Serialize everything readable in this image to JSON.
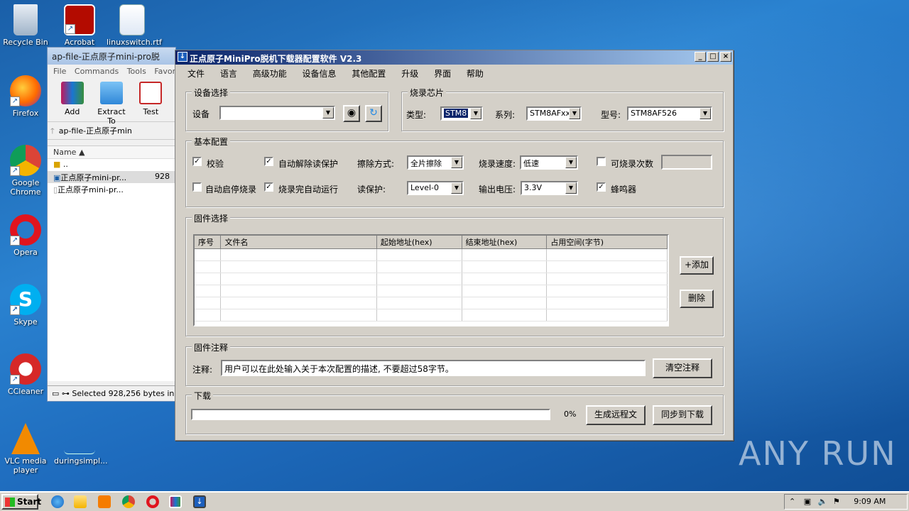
{
  "desktop": {
    "icons": [
      {
        "label": "Recycle Bin"
      },
      {
        "label": "Acrobat"
      },
      {
        "label": "linuxswitch.rtf"
      },
      {
        "label": "Firefox"
      },
      {
        "label": "Google Chrome"
      },
      {
        "label": "Opera"
      },
      {
        "label": "Skype"
      },
      {
        "label": "CCleaner"
      },
      {
        "label": "VLC media player"
      },
      {
        "label": "duringsimpl..."
      }
    ],
    "watermark": "ANY RUN"
  },
  "winrar": {
    "title": "ap-file-正点原子mini-pro脱",
    "menu": [
      "File",
      "Commands",
      "Tools",
      "Favorite"
    ],
    "tools": [
      "Add",
      "Extract To",
      "Test"
    ],
    "address": "ap-file-正点原子min",
    "column_name": "Name",
    "rows": [
      {
        "name": "..",
        "size": ""
      },
      {
        "name": "正点原子mini-pr...",
        "size": "928"
      },
      {
        "name": "正点原子mini-pr...",
        "size": ""
      }
    ],
    "status": "Selected 928,256 bytes in"
  },
  "app": {
    "title": "正点原子MiniPro脱机下载器配置软件 V2.3",
    "menu": [
      "文件",
      "语言",
      "高级功能",
      "设备信息",
      "其他配置",
      "升级",
      "界面",
      "帮助"
    ],
    "device": {
      "group": "设备选择",
      "label": "设备",
      "value": ""
    },
    "chip": {
      "group": "烧录芯片",
      "type_label": "类型:",
      "type_value": "STM8",
      "series_label": "系列:",
      "series_value": "STM8AFxx",
      "model_label": "型号:",
      "model_value": "STM8AF526"
    },
    "basic": {
      "group": "基本配置",
      "verify": {
        "label": "校验",
        "checked": "✓"
      },
      "auto_unlock": {
        "label": "自动解除读保护",
        "checked": "✓"
      },
      "erase_label": "擦除方式:",
      "erase_value": "全片擦除",
      "speed_label": "烧录速度:",
      "speed_value": "低速",
      "count_limit": {
        "label": "可烧录次数",
        "checked": ""
      },
      "count_value": "",
      "auto_start": {
        "label": "自动启停烧录",
        "checked": ""
      },
      "auto_run": {
        "label": "烧录完自动运行",
        "checked": "✓"
      },
      "readprot_label": "读保护:",
      "readprot_value": "Level-0",
      "voltage_label": "输出电压:",
      "voltage_value": "3.3V",
      "buzzer": {
        "label": "蜂鸣器",
        "checked": "✓"
      }
    },
    "firmware": {
      "group": "固件选择",
      "columns": [
        "序号",
        "文件名",
        "起始地址(hex)",
        "结束地址(hex)",
        "占用空间(字节)"
      ],
      "add_label": "+添加",
      "delete_label": "删除"
    },
    "note": {
      "group": "固件注释",
      "label": "注释:",
      "value": "用户可以在此处输入关于本次配置的描述, 不要超过58字节。",
      "clear_label": "清空注释"
    },
    "download": {
      "group": "下载",
      "progress_percent": 0,
      "progress_text": "0%",
      "gen_label": "生成远程文",
      "sync_label": "同步到下载"
    }
  },
  "taskbar": {
    "start_label": "Start",
    "clock": "9:09 AM"
  }
}
